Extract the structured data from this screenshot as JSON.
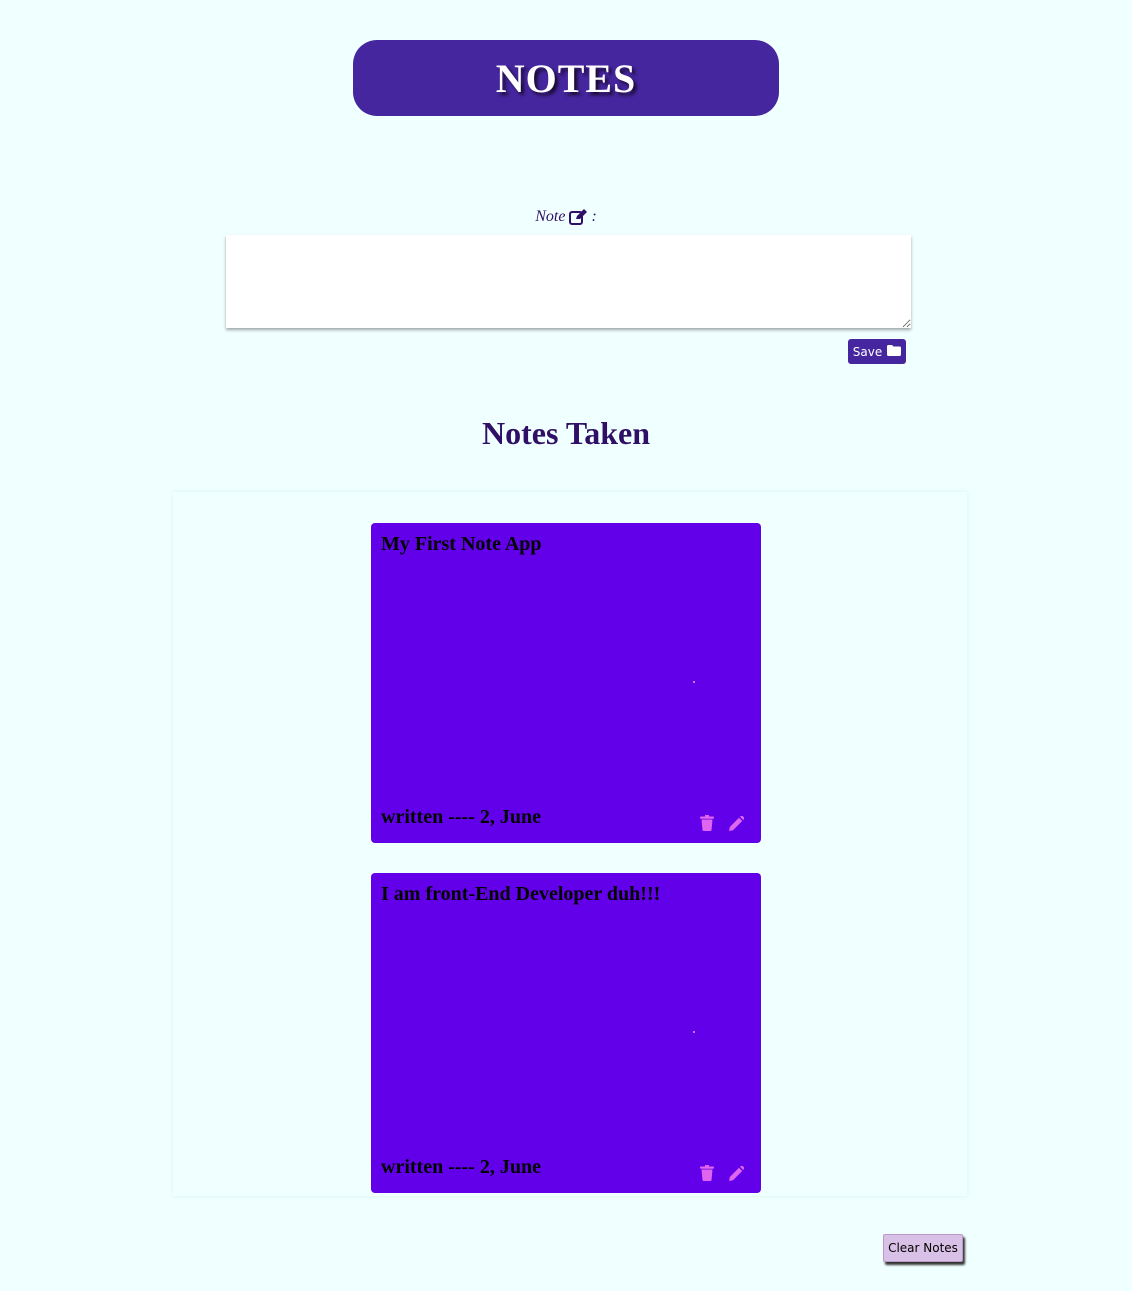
{
  "header": {
    "title": "NOTES"
  },
  "composer": {
    "label": "Note",
    "label_suffix": ":",
    "label_icon": "edit-square-icon",
    "textarea_value": "",
    "save_label": "Save",
    "save_icon": "folder-icon"
  },
  "notes_section": {
    "heading": "Notes Taken",
    "notes": [
      {
        "text": "My First Note App",
        "date": "written ---- 2, June",
        "delete_icon": "trash-icon",
        "edit_icon": "pencil-icon"
      },
      {
        "text": "I am front-End Developer duh!!!",
        "date": "written ---- 2, June",
        "delete_icon": "trash-icon",
        "edit_icon": "pencil-icon"
      }
    ]
  },
  "footer": {
    "clear_label": "Clear Notes"
  },
  "colors": {
    "background": "#f0ffff",
    "header_bg": "#45269e",
    "note_bg": "#6200ea",
    "icon_pink": "#e066f0",
    "heading_text": "#2f1066"
  }
}
